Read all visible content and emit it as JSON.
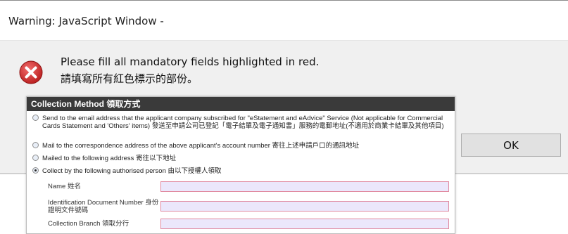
{
  "window": {
    "title": "Warning: JavaScript Window -"
  },
  "dialog": {
    "message_en": "Please fill all mandatory fields highlighted in red.",
    "message_zh": "請填寫所有紅色標示的部份。",
    "ok_label": "OK",
    "icon": "error-icon"
  },
  "form": {
    "header": "Collection Method 領取方式",
    "options": [
      {
        "text": "Send to the email address that the applicant company subscribed for \"eStatement and eAdvice\" Service (Not applicable for Commercial Cards Statement and 'Others' items) 發送至申請公司已登記「電子結單及電子通知書」服務的電郵地址(不適用於商業卡結單及其他項目)",
        "checked": false
      },
      {
        "text": "Mail to the correspondence address of the above applicant's account number 寄往上述申請戶口的通訊地址",
        "checked": false
      },
      {
        "text": "Mailed to the following address 寄往以下地址",
        "checked": false
      },
      {
        "text": "Collect by the following authorised person 由以下授權人領取",
        "checked": true
      }
    ],
    "fields": [
      {
        "label": "Name 姓名",
        "value": ""
      },
      {
        "label": "Identification Document Number 身份證明文件號碼",
        "value": ""
      },
      {
        "label": "Collection Branch 領取分行",
        "value": ""
      }
    ]
  },
  "colors": {
    "panel_header": "#3a3a3a",
    "field_bg": "#ebe7fb",
    "field_border": "#e08aa0",
    "error_red": "#c62828"
  }
}
